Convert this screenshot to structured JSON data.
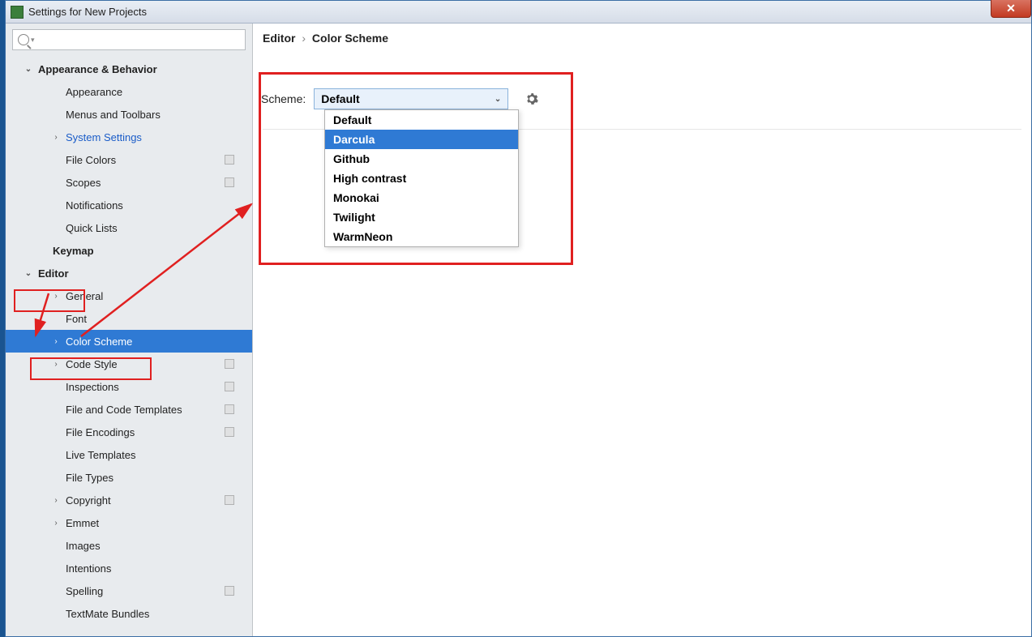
{
  "window": {
    "title": "Settings for New Projects"
  },
  "breadcrumb": {
    "part1": "Editor",
    "part2": "Color Scheme"
  },
  "scheme": {
    "label": "Scheme:",
    "selected": "Default",
    "options": [
      "Default",
      "Darcula",
      "Github",
      "High contrast",
      "Monokai",
      "Twilight",
      "WarmNeon"
    ],
    "hovered_index": 1
  },
  "sidebar": {
    "items": [
      {
        "label": "Appearance & Behavior",
        "level": 1,
        "arrow": "down",
        "bold": true
      },
      {
        "label": "Appearance",
        "level": 2,
        "arrow": "none"
      },
      {
        "label": "Menus and Toolbars",
        "level": 2,
        "arrow": "none"
      },
      {
        "label": "System Settings",
        "level": 2,
        "arrow": "right",
        "link": true
      },
      {
        "label": "File Colors",
        "level": 2,
        "arrow": "none",
        "folder": true
      },
      {
        "label": "Scopes",
        "level": 2,
        "arrow": "none",
        "folder": true
      },
      {
        "label": "Notifications",
        "level": 2,
        "arrow": "none"
      },
      {
        "label": "Quick Lists",
        "level": 2,
        "arrow": "none"
      },
      {
        "label": "Keymap",
        "level": 1,
        "arrow": "blank",
        "bold": true
      },
      {
        "label": "Editor",
        "level": 1,
        "arrow": "down",
        "bold": true
      },
      {
        "label": "General",
        "level": 2,
        "arrow": "right"
      },
      {
        "label": "Font",
        "level": 2,
        "arrow": "none"
      },
      {
        "label": "Color Scheme",
        "level": 2,
        "arrow": "right",
        "selected": true
      },
      {
        "label": "Code Style",
        "level": 2,
        "arrow": "right",
        "folder": true
      },
      {
        "label": "Inspections",
        "level": 2,
        "arrow": "none",
        "folder": true
      },
      {
        "label": "File and Code Templates",
        "level": 2,
        "arrow": "none",
        "folder": true
      },
      {
        "label": "File Encodings",
        "level": 2,
        "arrow": "none",
        "folder": true
      },
      {
        "label": "Live Templates",
        "level": 2,
        "arrow": "none"
      },
      {
        "label": "File Types",
        "level": 2,
        "arrow": "none"
      },
      {
        "label": "Copyright",
        "level": 2,
        "arrow": "right",
        "folder": true
      },
      {
        "label": "Emmet",
        "level": 2,
        "arrow": "right"
      },
      {
        "label": "Images",
        "level": 2,
        "arrow": "none"
      },
      {
        "label": "Intentions",
        "level": 2,
        "arrow": "none"
      },
      {
        "label": "Spelling",
        "level": 2,
        "arrow": "none",
        "folder": true
      },
      {
        "label": "TextMate Bundles",
        "level": 2,
        "arrow": "none"
      }
    ]
  }
}
